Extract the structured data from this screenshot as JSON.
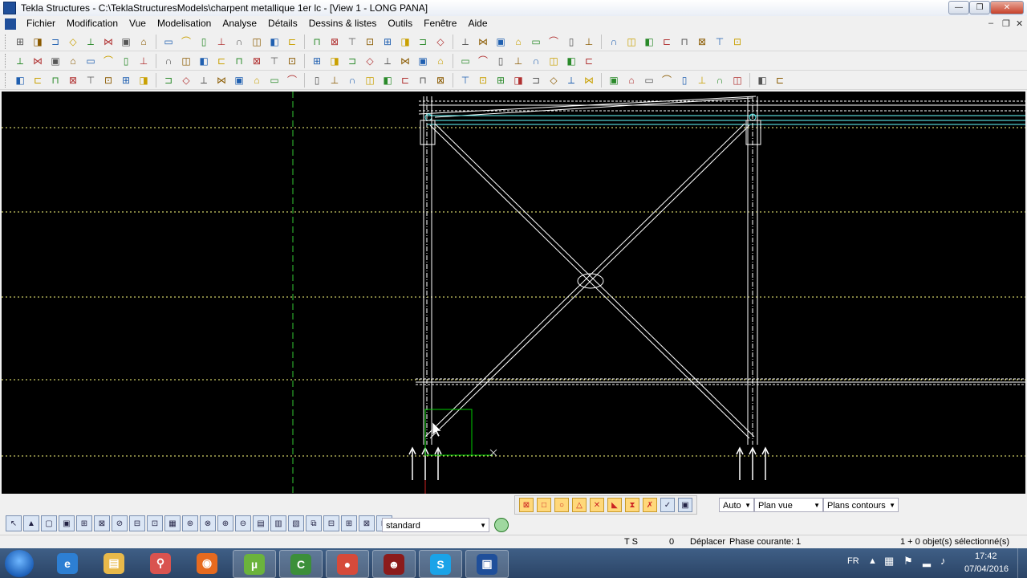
{
  "window": {
    "title": "Tekla Structures - C:\\TeklaStructuresModels\\charpent metallique 1er lc - [View 1 - LONG PANA]",
    "minimize": "—",
    "maximize": "❐",
    "close": "✕"
  },
  "menu": {
    "items": [
      "Fichier",
      "Modification",
      "Vue",
      "Modelisation",
      "Analyse",
      "Détails",
      "Dessins & listes",
      "Outils",
      "Fenêtre",
      "Aide"
    ],
    "mdi_minimize": "–",
    "mdi_restore": "❐",
    "mdi_close": "✕"
  },
  "toolbars": {
    "row1_count": 40,
    "row2_count": 32,
    "row3_count": 42
  },
  "snap": {
    "icon_count": 10
  },
  "combos": {
    "auto": "Auto",
    "plan_vue": "Plan vue",
    "plans_contours": "Plans contours",
    "standard": "standard"
  },
  "selection": {
    "icon_count": 22
  },
  "status": {
    "ts": "T S",
    "zero": "0",
    "command": "Déplacer",
    "phase": "Phase courante: 1",
    "selected": "1 + 0 objet(s) sélectionné(s)"
  },
  "taskbar": {
    "apps": [
      {
        "name": "internet-explorer",
        "glyph": "e",
        "color": "#2d7fd3"
      },
      {
        "name": "file-explorer",
        "glyph": "▤",
        "color": "#e8b94a"
      },
      {
        "name": "search-tool",
        "glyph": "⚲",
        "color": "#d9534f"
      },
      {
        "name": "firefox",
        "glyph": "◉",
        "color": "#e66a1f"
      },
      {
        "name": "utorrent",
        "glyph": "µ",
        "color": "#6bb33c"
      },
      {
        "name": "camtasia",
        "glyph": "C",
        "color": "#3c8f3a"
      },
      {
        "name": "chrome",
        "glyph": "●",
        "color": "#d64a3a"
      },
      {
        "name": "media-app",
        "glyph": "☻",
        "color": "#8b1b1b"
      },
      {
        "name": "skype",
        "glyph": "S",
        "color": "#1aa3e8"
      },
      {
        "name": "tekla",
        "glyph": "▣",
        "color": "#1f4f9a"
      }
    ],
    "lang": "FR",
    "time": "17:42",
    "date": "07/04/2016"
  },
  "colors": {
    "grid_line": "#ffff80",
    "member": "#ffffff",
    "axis_green": "#33cc33",
    "handle_cyan": "#66ffff",
    "selection_green": "#00cc00"
  }
}
